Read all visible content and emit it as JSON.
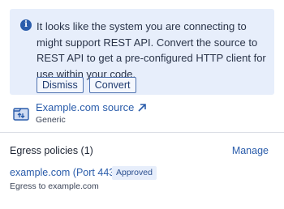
{
  "banner": {
    "icon": "info-icon",
    "message": "It looks like the system you are connecting to might support REST API. Convert the source to REST API to get a pre-configured HTTP client for use within your code.",
    "dismiss_label": "Dismiss",
    "convert_label": "Convert"
  },
  "source": {
    "icon": "source-database-icon",
    "name": "Example.com source",
    "link_icon": "arrow-up-right-icon",
    "type": "Generic"
  },
  "egress": {
    "title": "Egress policies (1)",
    "manage_label": "Manage",
    "policies": [
      {
        "name": "example.com (Port 443)",
        "status": "Approved",
        "description": "Egress to example.com"
      }
    ]
  },
  "colors": {
    "accent": "#2b5dab",
    "banner_bg": "#e7eefb",
    "divider": "#dcdfe6"
  }
}
